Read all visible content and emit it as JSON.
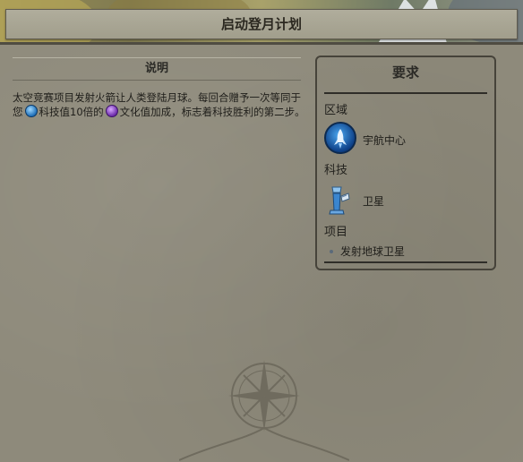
{
  "window": {
    "title": "启动登月计划"
  },
  "description": {
    "header": "说明",
    "segments": [
      {
        "type": "text",
        "value": "太空竞赛项目发射火箭让人类登陆月球。每回合赠予一次等同于您"
      },
      {
        "type": "icon",
        "name": "science-icon"
      },
      {
        "type": "text",
        "value": "科技值10倍的"
      },
      {
        "type": "icon",
        "name": "culture-icon"
      },
      {
        "type": "text",
        "value": "文化值加成，标志着科技胜利的第二步。"
      }
    ],
    "text_part1": "太空竞赛项目发射火箭让人类登陆月球。每回合赠予一次等同于您",
    "text_part2": "科技值10倍的",
    "text_part3": "文化值加成，标志着科技胜利的第二步。"
  },
  "requirements": {
    "title": "要求",
    "district_label": "区域",
    "district_value": "宇航中心",
    "district_icon": "spaceport-icon",
    "tech_label": "科技",
    "tech_value": "卫星",
    "tech_icon": "satellite-icon",
    "project_label": "项目",
    "project_value": "发射地球卫星"
  },
  "colors": {
    "science": "#1e6fb8",
    "culture": "#6b2aa8",
    "parchment": "#8e8a7b"
  }
}
